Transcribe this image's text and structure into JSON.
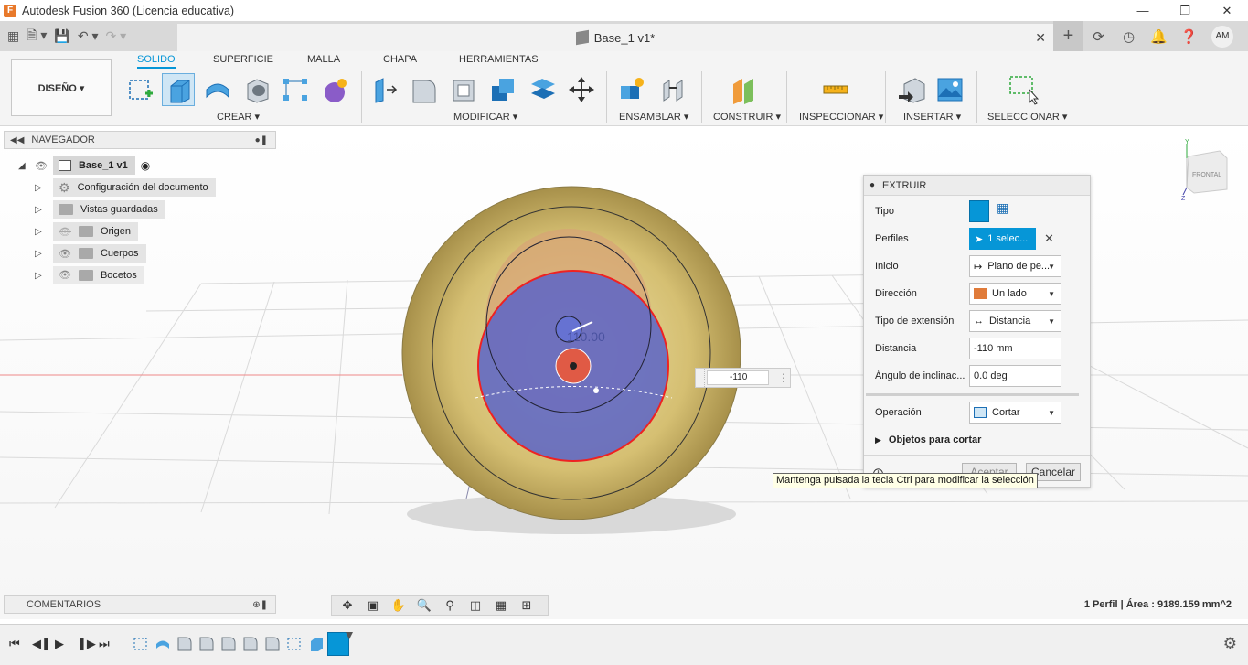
{
  "app": {
    "title": "Autodesk Fusion 360 (Licencia educativa)",
    "logo_letter": "F"
  },
  "document": {
    "title": "Base_1 v1*",
    "close": "✕"
  },
  "account": {
    "initials": "AM"
  },
  "ribbon": {
    "workspace": "DISEÑO ▾",
    "tabs": [
      "SOLIDO",
      "SUPERFICIE",
      "MALLA",
      "CHAPA",
      "HERRAMIENTAS"
    ],
    "groups": {
      "create": "CREAR ▾",
      "modify": "MODIFICAR ▾",
      "assemble": "ENSAMBLAR ▾",
      "construct": "CONSTRUIR ▾",
      "inspect": "INSPECCIONAR ▾",
      "insert": "INSERTAR ▾",
      "select": "SELECCIONAR ▾"
    }
  },
  "navigator": {
    "title": "NAVEGADOR",
    "root": "Base_1 v1",
    "items": [
      {
        "label": "Configuración del documento"
      },
      {
        "label": "Vistas guardadas"
      },
      {
        "label": "Origen"
      },
      {
        "label": "Cuerpos"
      },
      {
        "label": "Bocetos"
      }
    ]
  },
  "viewcube": {
    "label": "FRONTAL",
    "axes": {
      "x": "X",
      "y": "Y",
      "z": "Z"
    }
  },
  "viewport": {
    "dimension_value": "110.00",
    "input_value": "-110"
  },
  "extrude": {
    "title": "EXTRUIR",
    "rows": {
      "tipo": "Tipo",
      "perfiles": "Perfiles",
      "perfiles_value": "1 selec...",
      "inicio": "Inicio",
      "inicio_value": "Plano de pe...",
      "direccion": "Dirección",
      "direccion_value": "Un lado",
      "tipo_extension": "Tipo de extensión",
      "tipo_extension_value": "Distancia",
      "distancia": "Distancia",
      "distancia_value": "-110 mm",
      "angulo": "Ángulo de inclinac...",
      "angulo_value": "0.0 deg",
      "operacion": "Operación",
      "operacion_value": "Cortar",
      "objetos": "Objetos para cortar"
    },
    "ok": "Aceptar",
    "cancel": "Cancelar"
  },
  "tooltip": "Mantenga pulsada la tecla Ctrl para modificar la selección",
  "comments": {
    "title": "COMENTARIOS"
  },
  "status": "1 Perfil | Área : 9189.159 mm^2",
  "colors": {
    "accent": "#0696d7",
    "body_gold": "#c9b56a",
    "profile_blue": "#5a64c8",
    "cut_red": "#e24a3a"
  }
}
